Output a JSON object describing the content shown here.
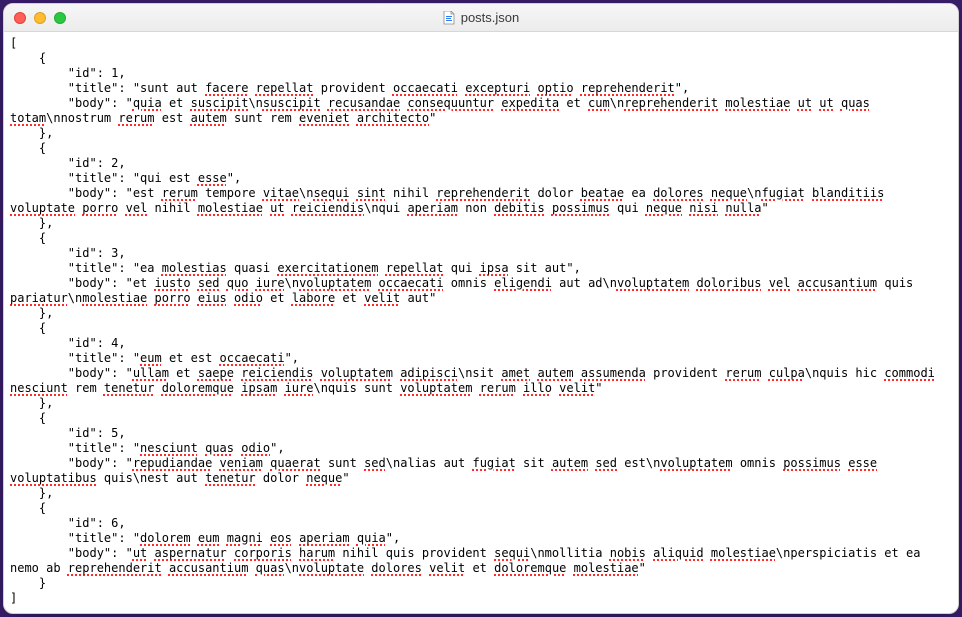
{
  "window": {
    "title": "posts.json",
    "icon_name": "json-document-icon"
  },
  "posts": [
    {
      "id": 1,
      "title": "sunt aut facere repellat provident occaecati excepturi optio reprehenderit",
      "body": "quia et suscipit\\nsuscipit recusandae consequuntur expedita et cum\\nreprehenderit molestiae ut ut quas totam\\nnostrum rerum est autem sunt rem eveniet architecto"
    },
    {
      "id": 2,
      "title": "qui est esse",
      "body": "est rerum tempore vitae\\nsequi sint nihil reprehenderit dolor beatae ea dolores neque\\nfugiat blanditiis voluptate porro vel nihil molestiae ut reiciendis\\nqui aperiam non debitis possimus qui neque nisi nulla"
    },
    {
      "id": 3,
      "title": "ea molestias quasi exercitationem repellat qui ipsa sit aut",
      "body": "et iusto sed quo iure\\nvoluptatem occaecati omnis eligendi aut ad\\nvoluptatem doloribus vel accusantium quis pariatur\\nmolestiae porro eius odio et labore et velit aut"
    },
    {
      "id": 4,
      "title": "eum et est occaecati",
      "body": "ullam et saepe reiciendis voluptatem adipisci\\nsit amet autem assumenda provident rerum culpa\\nquis hic commodi nesciunt rem tenetur doloremque ipsam iure\\nquis sunt voluptatem rerum illo velit"
    },
    {
      "id": 5,
      "title": "nesciunt quas odio",
      "body": "repudiandae veniam quaerat sunt sed\\nalias aut fugiat sit autem sed est\\nvoluptatem omnis possimus esse voluptatibus quis\\nest aut tenetur dolor neque"
    },
    {
      "id": 6,
      "title": "dolorem eum magni eos aperiam quia",
      "body": "ut aspernatur corporis harum nihil quis provident sequi\\nmollitia nobis aliquid molestiae\\nperspiciatis et ea nemo ab reprehenderit accusantium quas\\nvoluptate dolores velit et doloremque molestiae"
    }
  ],
  "spellcheck_words": [
    "facere",
    "repellat",
    "occaecati",
    "excepturi",
    "optio",
    "reprehenderit",
    "quia",
    "suscipit",
    "nsuscipit",
    "recusandae",
    "consequuntur",
    "expedita",
    "cum",
    "nreprehenderit",
    "molestiae",
    "ut",
    "quas",
    "totam",
    "nnostrum",
    "rerum",
    "autem",
    "eveniet",
    "architecto",
    "esse",
    "vitae",
    "nsequi",
    "sint",
    "beatae",
    "neque",
    "nfugiat",
    "blanditiis",
    "voluptate",
    "porro",
    "vel",
    "reiciendis",
    "nqui",
    "aperiam",
    "debitis",
    "possimus",
    "nisi",
    "nulla",
    "molestias",
    "exercitationem",
    "ipsa",
    "iusto",
    "quo",
    "iure",
    "nvoluptatem",
    "eligendi",
    "doloribus",
    "accusantium",
    "pariatur",
    "nmolestiae",
    "eius",
    "odio",
    "labore",
    "velit",
    "eum",
    "occaecati",
    "ullam",
    "saepe",
    "voluptatem",
    "adipisci",
    "nsit",
    "amet",
    "assumenda",
    "rerum",
    "culpa",
    "nquis",
    "commodi",
    "nesciunt",
    "tenetur",
    "doloremque",
    "ipsam",
    "nquis",
    "illo",
    "repudiandae",
    "veniam",
    "quaerat",
    "sed",
    "nalias",
    "fugiat",
    "voluptatibus",
    "nest",
    "dolorem",
    "magni",
    "eos",
    "aspernatur",
    "corporis",
    "harum",
    "sequi",
    "nmollitia",
    "nobis",
    "aliquid",
    "nperspiciatis",
    "nvoluptate",
    "dolores"
  ]
}
